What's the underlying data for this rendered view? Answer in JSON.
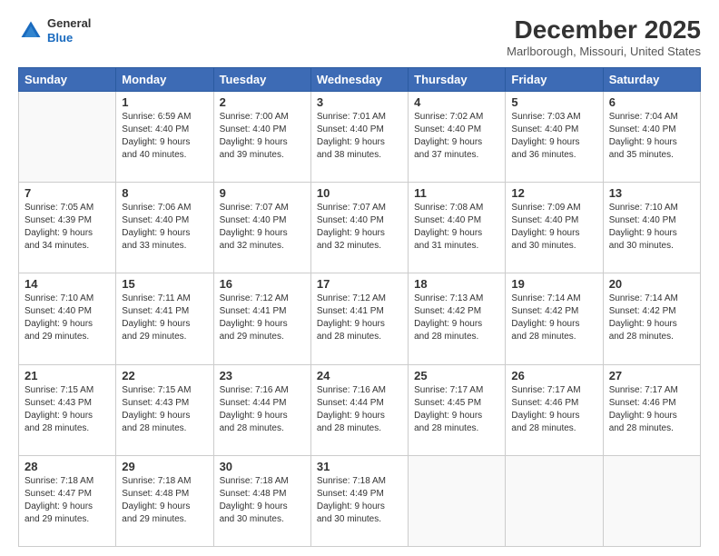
{
  "logo": {
    "general": "General",
    "blue": "Blue"
  },
  "header": {
    "month": "December 2025",
    "location": "Marlborough, Missouri, United States"
  },
  "weekdays": [
    "Sunday",
    "Monday",
    "Tuesday",
    "Wednesday",
    "Thursday",
    "Friday",
    "Saturday"
  ],
  "weeks": [
    [
      {
        "day": "",
        "sunrise": "",
        "sunset": "",
        "daylight": "",
        "empty": true
      },
      {
        "day": "1",
        "sunrise": "Sunrise: 6:59 AM",
        "sunset": "Sunset: 4:40 PM",
        "daylight": "Daylight: 9 hours and 40 minutes."
      },
      {
        "day": "2",
        "sunrise": "Sunrise: 7:00 AM",
        "sunset": "Sunset: 4:40 PM",
        "daylight": "Daylight: 9 hours and 39 minutes."
      },
      {
        "day": "3",
        "sunrise": "Sunrise: 7:01 AM",
        "sunset": "Sunset: 4:40 PM",
        "daylight": "Daylight: 9 hours and 38 minutes."
      },
      {
        "day": "4",
        "sunrise": "Sunrise: 7:02 AM",
        "sunset": "Sunset: 4:40 PM",
        "daylight": "Daylight: 9 hours and 37 minutes."
      },
      {
        "day": "5",
        "sunrise": "Sunrise: 7:03 AM",
        "sunset": "Sunset: 4:40 PM",
        "daylight": "Daylight: 9 hours and 36 minutes."
      },
      {
        "day": "6",
        "sunrise": "Sunrise: 7:04 AM",
        "sunset": "Sunset: 4:40 PM",
        "daylight": "Daylight: 9 hours and 35 minutes."
      }
    ],
    [
      {
        "day": "7",
        "sunrise": "Sunrise: 7:05 AM",
        "sunset": "Sunset: 4:39 PM",
        "daylight": "Daylight: 9 hours and 34 minutes."
      },
      {
        "day": "8",
        "sunrise": "Sunrise: 7:06 AM",
        "sunset": "Sunset: 4:40 PM",
        "daylight": "Daylight: 9 hours and 33 minutes."
      },
      {
        "day": "9",
        "sunrise": "Sunrise: 7:07 AM",
        "sunset": "Sunset: 4:40 PM",
        "daylight": "Daylight: 9 hours and 32 minutes."
      },
      {
        "day": "10",
        "sunrise": "Sunrise: 7:07 AM",
        "sunset": "Sunset: 4:40 PM",
        "daylight": "Daylight: 9 hours and 32 minutes."
      },
      {
        "day": "11",
        "sunrise": "Sunrise: 7:08 AM",
        "sunset": "Sunset: 4:40 PM",
        "daylight": "Daylight: 9 hours and 31 minutes."
      },
      {
        "day": "12",
        "sunrise": "Sunrise: 7:09 AM",
        "sunset": "Sunset: 4:40 PM",
        "daylight": "Daylight: 9 hours and 30 minutes."
      },
      {
        "day": "13",
        "sunrise": "Sunrise: 7:10 AM",
        "sunset": "Sunset: 4:40 PM",
        "daylight": "Daylight: 9 hours and 30 minutes."
      }
    ],
    [
      {
        "day": "14",
        "sunrise": "Sunrise: 7:10 AM",
        "sunset": "Sunset: 4:40 PM",
        "daylight": "Daylight: 9 hours and 29 minutes."
      },
      {
        "day": "15",
        "sunrise": "Sunrise: 7:11 AM",
        "sunset": "Sunset: 4:41 PM",
        "daylight": "Daylight: 9 hours and 29 minutes."
      },
      {
        "day": "16",
        "sunrise": "Sunrise: 7:12 AM",
        "sunset": "Sunset: 4:41 PM",
        "daylight": "Daylight: 9 hours and 29 minutes."
      },
      {
        "day": "17",
        "sunrise": "Sunrise: 7:12 AM",
        "sunset": "Sunset: 4:41 PM",
        "daylight": "Daylight: 9 hours and 28 minutes."
      },
      {
        "day": "18",
        "sunrise": "Sunrise: 7:13 AM",
        "sunset": "Sunset: 4:42 PM",
        "daylight": "Daylight: 9 hours and 28 minutes."
      },
      {
        "day": "19",
        "sunrise": "Sunrise: 7:14 AM",
        "sunset": "Sunset: 4:42 PM",
        "daylight": "Daylight: 9 hours and 28 minutes."
      },
      {
        "day": "20",
        "sunrise": "Sunrise: 7:14 AM",
        "sunset": "Sunset: 4:42 PM",
        "daylight": "Daylight: 9 hours and 28 minutes."
      }
    ],
    [
      {
        "day": "21",
        "sunrise": "Sunrise: 7:15 AM",
        "sunset": "Sunset: 4:43 PM",
        "daylight": "Daylight: 9 hours and 28 minutes."
      },
      {
        "day": "22",
        "sunrise": "Sunrise: 7:15 AM",
        "sunset": "Sunset: 4:43 PM",
        "daylight": "Daylight: 9 hours and 28 minutes."
      },
      {
        "day": "23",
        "sunrise": "Sunrise: 7:16 AM",
        "sunset": "Sunset: 4:44 PM",
        "daylight": "Daylight: 9 hours and 28 minutes."
      },
      {
        "day": "24",
        "sunrise": "Sunrise: 7:16 AM",
        "sunset": "Sunset: 4:44 PM",
        "daylight": "Daylight: 9 hours and 28 minutes."
      },
      {
        "day": "25",
        "sunrise": "Sunrise: 7:17 AM",
        "sunset": "Sunset: 4:45 PM",
        "daylight": "Daylight: 9 hours and 28 minutes."
      },
      {
        "day": "26",
        "sunrise": "Sunrise: 7:17 AM",
        "sunset": "Sunset: 4:46 PM",
        "daylight": "Daylight: 9 hours and 28 minutes."
      },
      {
        "day": "27",
        "sunrise": "Sunrise: 7:17 AM",
        "sunset": "Sunset: 4:46 PM",
        "daylight": "Daylight: 9 hours and 28 minutes."
      }
    ],
    [
      {
        "day": "28",
        "sunrise": "Sunrise: 7:18 AM",
        "sunset": "Sunset: 4:47 PM",
        "daylight": "Daylight: 9 hours and 29 minutes."
      },
      {
        "day": "29",
        "sunrise": "Sunrise: 7:18 AM",
        "sunset": "Sunset: 4:48 PM",
        "daylight": "Daylight: 9 hours and 29 minutes."
      },
      {
        "day": "30",
        "sunrise": "Sunrise: 7:18 AM",
        "sunset": "Sunset: 4:48 PM",
        "daylight": "Daylight: 9 hours and 30 minutes."
      },
      {
        "day": "31",
        "sunrise": "Sunrise: 7:18 AM",
        "sunset": "Sunset: 4:49 PM",
        "daylight": "Daylight: 9 hours and 30 minutes."
      },
      {
        "day": "",
        "sunrise": "",
        "sunset": "",
        "daylight": "",
        "empty": true
      },
      {
        "day": "",
        "sunrise": "",
        "sunset": "",
        "daylight": "",
        "empty": true
      },
      {
        "day": "",
        "sunrise": "",
        "sunset": "",
        "daylight": "",
        "empty": true
      }
    ]
  ]
}
